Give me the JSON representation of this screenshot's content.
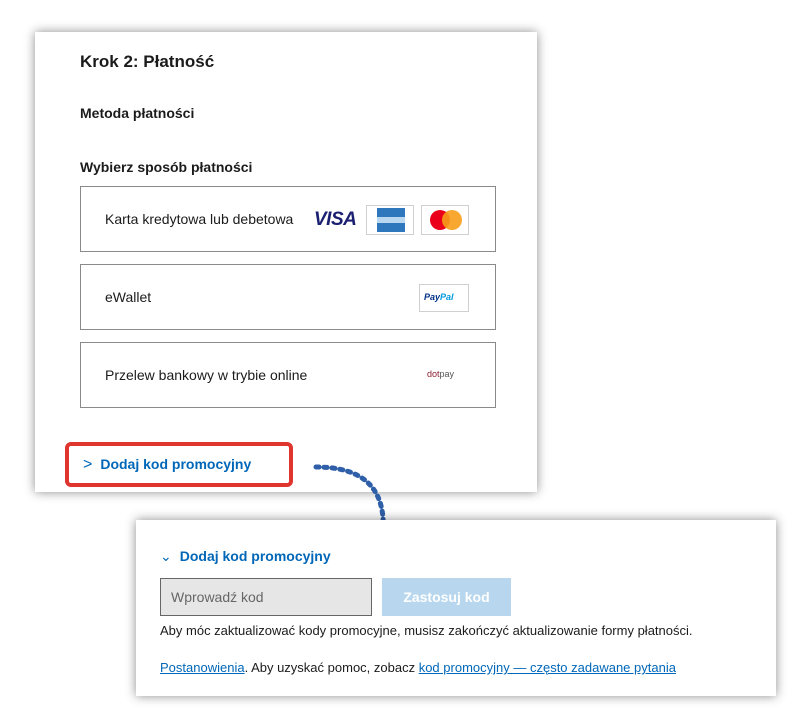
{
  "step_title": "Krok 2: Płatność",
  "section_title": "Metoda płatności",
  "choose_label": "Wybierz sposób płatności",
  "payment_methods": [
    {
      "label": "Karta kredytowa lub debetowa",
      "logos": [
        "VISA",
        "American Express",
        "Mastercard"
      ]
    },
    {
      "label": "eWallet",
      "logos": [
        "PayPal"
      ]
    },
    {
      "label": "Przelew bankowy w trybie online",
      "logos": [
        "dotpay"
      ]
    }
  ],
  "visa_text": "VISA",
  "paypal_text_1": "Pay",
  "paypal_text_2": "Pal",
  "dotpay_text_1": "dot",
  "dotpay_text_2": "pay",
  "promo_link_collapsed": "Dodaj kod promocyjny",
  "promo_link_expanded": "Dodaj kod promocyjny",
  "promo_input": {
    "placeholder": "Wprowadź kod",
    "value": ""
  },
  "apply_button": "Zastosuj kod",
  "info_text": "Aby móc zaktualizować kody promocyjne, musisz zakończyć aktualizowanie formy płatności.",
  "footer": {
    "terms_link": "Postanowienia",
    "middle_text": ". Aby uzyskać pomoc, zobacz ",
    "faq_link": "kod promocyjny — często zadawane pytania"
  },
  "colors": {
    "link_blue": "#0067b8",
    "highlight_red": "#e0342f",
    "apply_disabled": "#b8d7ee"
  }
}
